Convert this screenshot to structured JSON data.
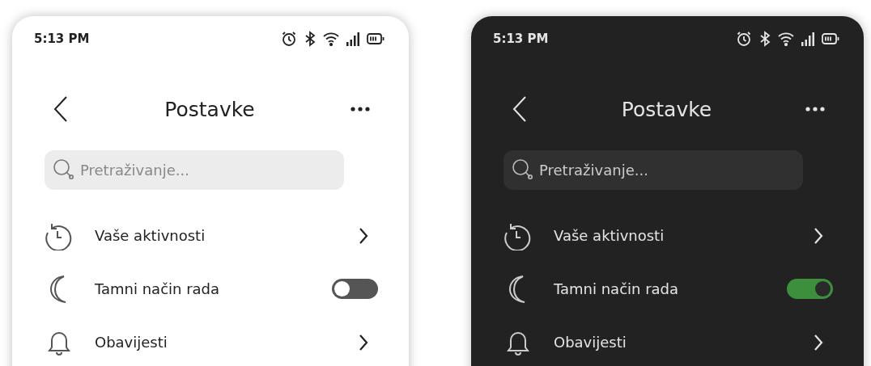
{
  "phones": [
    {
      "kind": "light",
      "status_bar": {
        "time": "5:13 PM"
      },
      "header": {
        "title": "Postavke"
      },
      "search": {
        "placeholder": "Pretraživanje..."
      },
      "items": [
        {
          "kind": "link",
          "label": "Vaše aktivnosti"
        },
        {
          "kind": "toggle",
          "label": "Tamni način rada",
          "on": false
        },
        {
          "kind": "link",
          "label": "Obavijesti"
        }
      ]
    },
    {
      "kind": "dark",
      "status_bar": {
        "time": "5:13 PM"
      },
      "header": {
        "title": "Postavke"
      },
      "search": {
        "placeholder": "Pretraživanje..."
      },
      "items": [
        {
          "kind": "link",
          "label": "Vaše aktivnosti"
        },
        {
          "kind": "toggle",
          "label": "Tamni način rada",
          "on": true
        },
        {
          "kind": "link",
          "label": "Obavijesti"
        }
      ]
    }
  ]
}
